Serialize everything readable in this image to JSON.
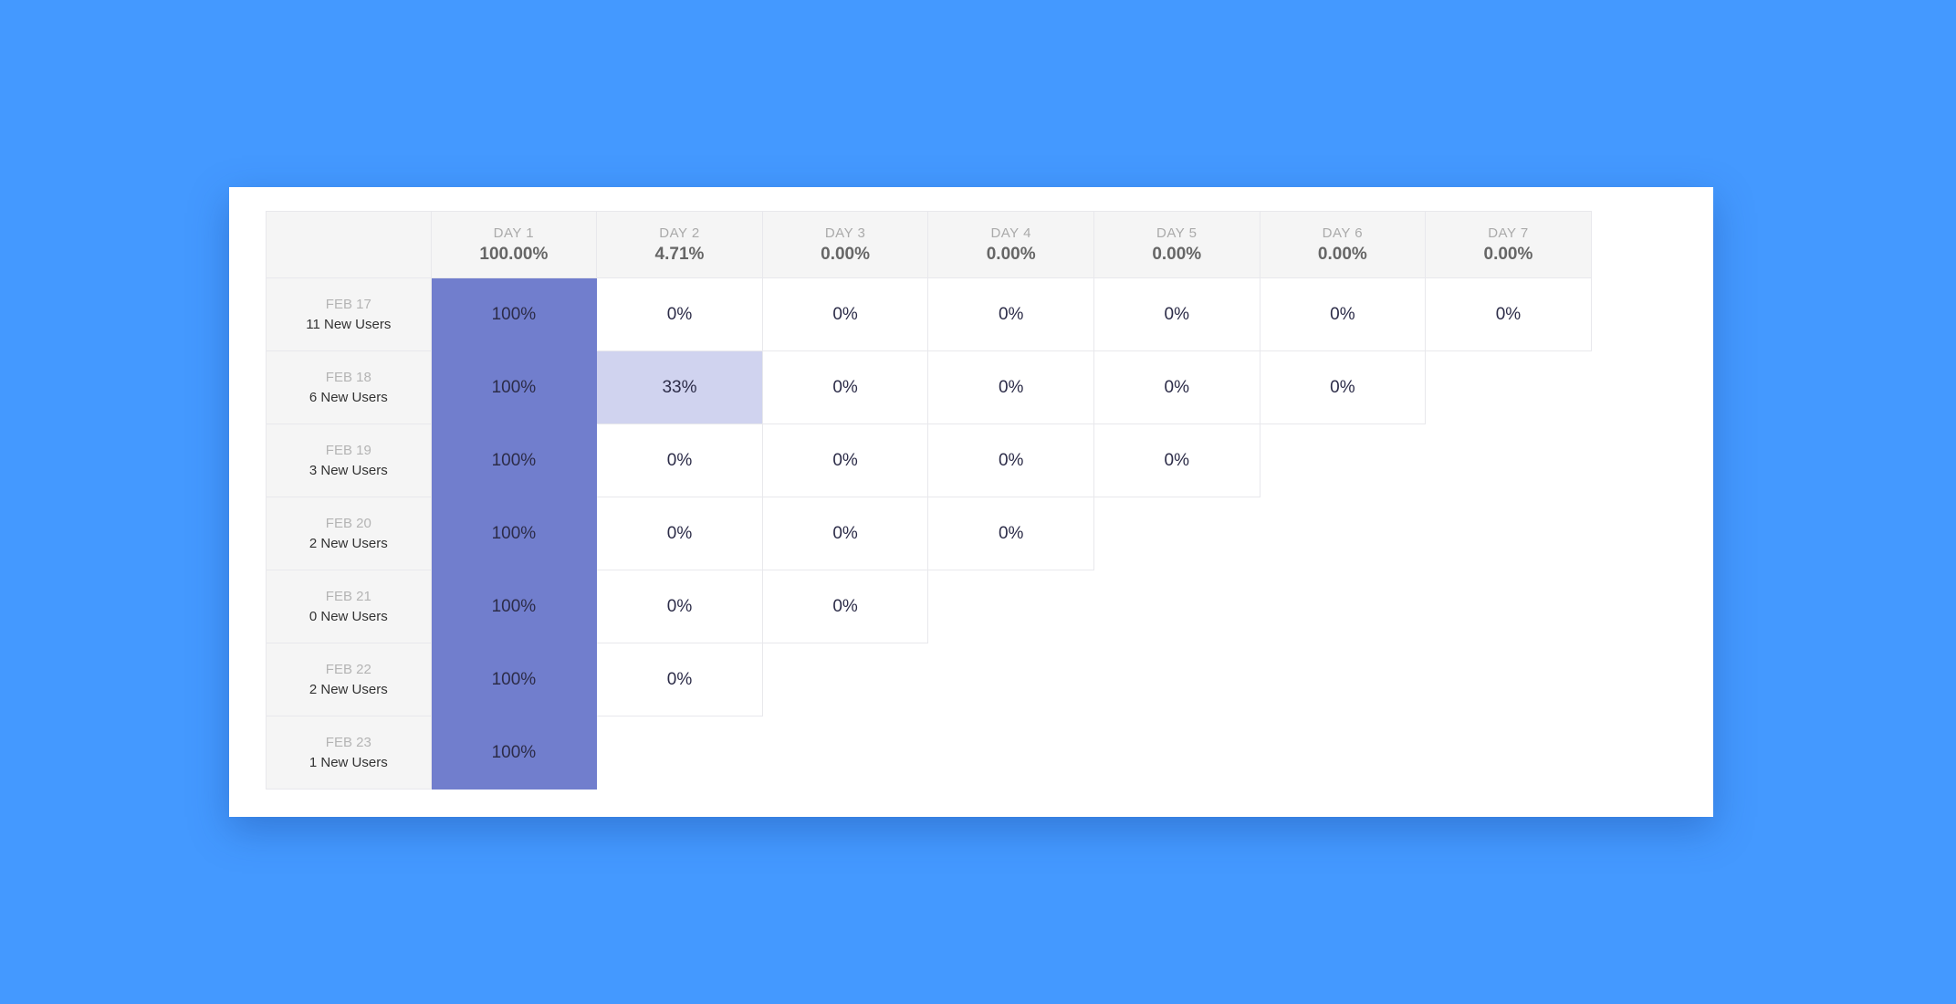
{
  "colors": {
    "page_background": "#4499ff",
    "card_background": "#ffffff",
    "header_background": "#f5f5f5",
    "retention_full": "#717ecd",
    "retention_partial": "#d0d3ef",
    "retention_zero": "#ffffff"
  },
  "cohort_table": {
    "corner_label": "",
    "days": [
      {
        "label": "DAY 1",
        "rate": "100.00%"
      },
      {
        "label": "DAY 2",
        "rate": "4.71%"
      },
      {
        "label": "DAY 3",
        "rate": "0.00%"
      },
      {
        "label": "DAY 4",
        "rate": "0.00%"
      },
      {
        "label": "DAY 5",
        "rate": "0.00%"
      },
      {
        "label": "DAY 6",
        "rate": "0.00%"
      },
      {
        "label": "DAY 7",
        "rate": "0.00%"
      }
    ],
    "cohorts": [
      {
        "date": "FEB 17",
        "users": "11 New Users",
        "values": [
          "100%",
          "0%",
          "0%",
          "0%",
          "0%",
          "0%",
          "0%"
        ],
        "shade": [
          1,
          0,
          0,
          0,
          0,
          0,
          0
        ]
      },
      {
        "date": "FEB 18",
        "users": "6 New Users",
        "values": [
          "100%",
          "33%",
          "0%",
          "0%",
          "0%",
          "0%"
        ],
        "shade": [
          1,
          0.33,
          0,
          0,
          0,
          0
        ]
      },
      {
        "date": "FEB 19",
        "users": "3 New Users",
        "values": [
          "100%",
          "0%",
          "0%",
          "0%",
          "0%"
        ],
        "shade": [
          1,
          0,
          0,
          0,
          0
        ]
      },
      {
        "date": "FEB 20",
        "users": "2 New Users",
        "values": [
          "100%",
          "0%",
          "0%",
          "0%"
        ],
        "shade": [
          1,
          0,
          0,
          0
        ]
      },
      {
        "date": "FEB 21",
        "users": "0 New Users",
        "values": [
          "100%",
          "0%",
          "0%"
        ],
        "shade": [
          1,
          0,
          0
        ]
      },
      {
        "date": "FEB 22",
        "users": "2 New Users",
        "values": [
          "100%",
          "0%"
        ],
        "shade": [
          1,
          0
        ]
      },
      {
        "date": "FEB 23",
        "users": "1 New Users",
        "values": [
          "100%"
        ],
        "shade": [
          1
        ]
      }
    ]
  }
}
